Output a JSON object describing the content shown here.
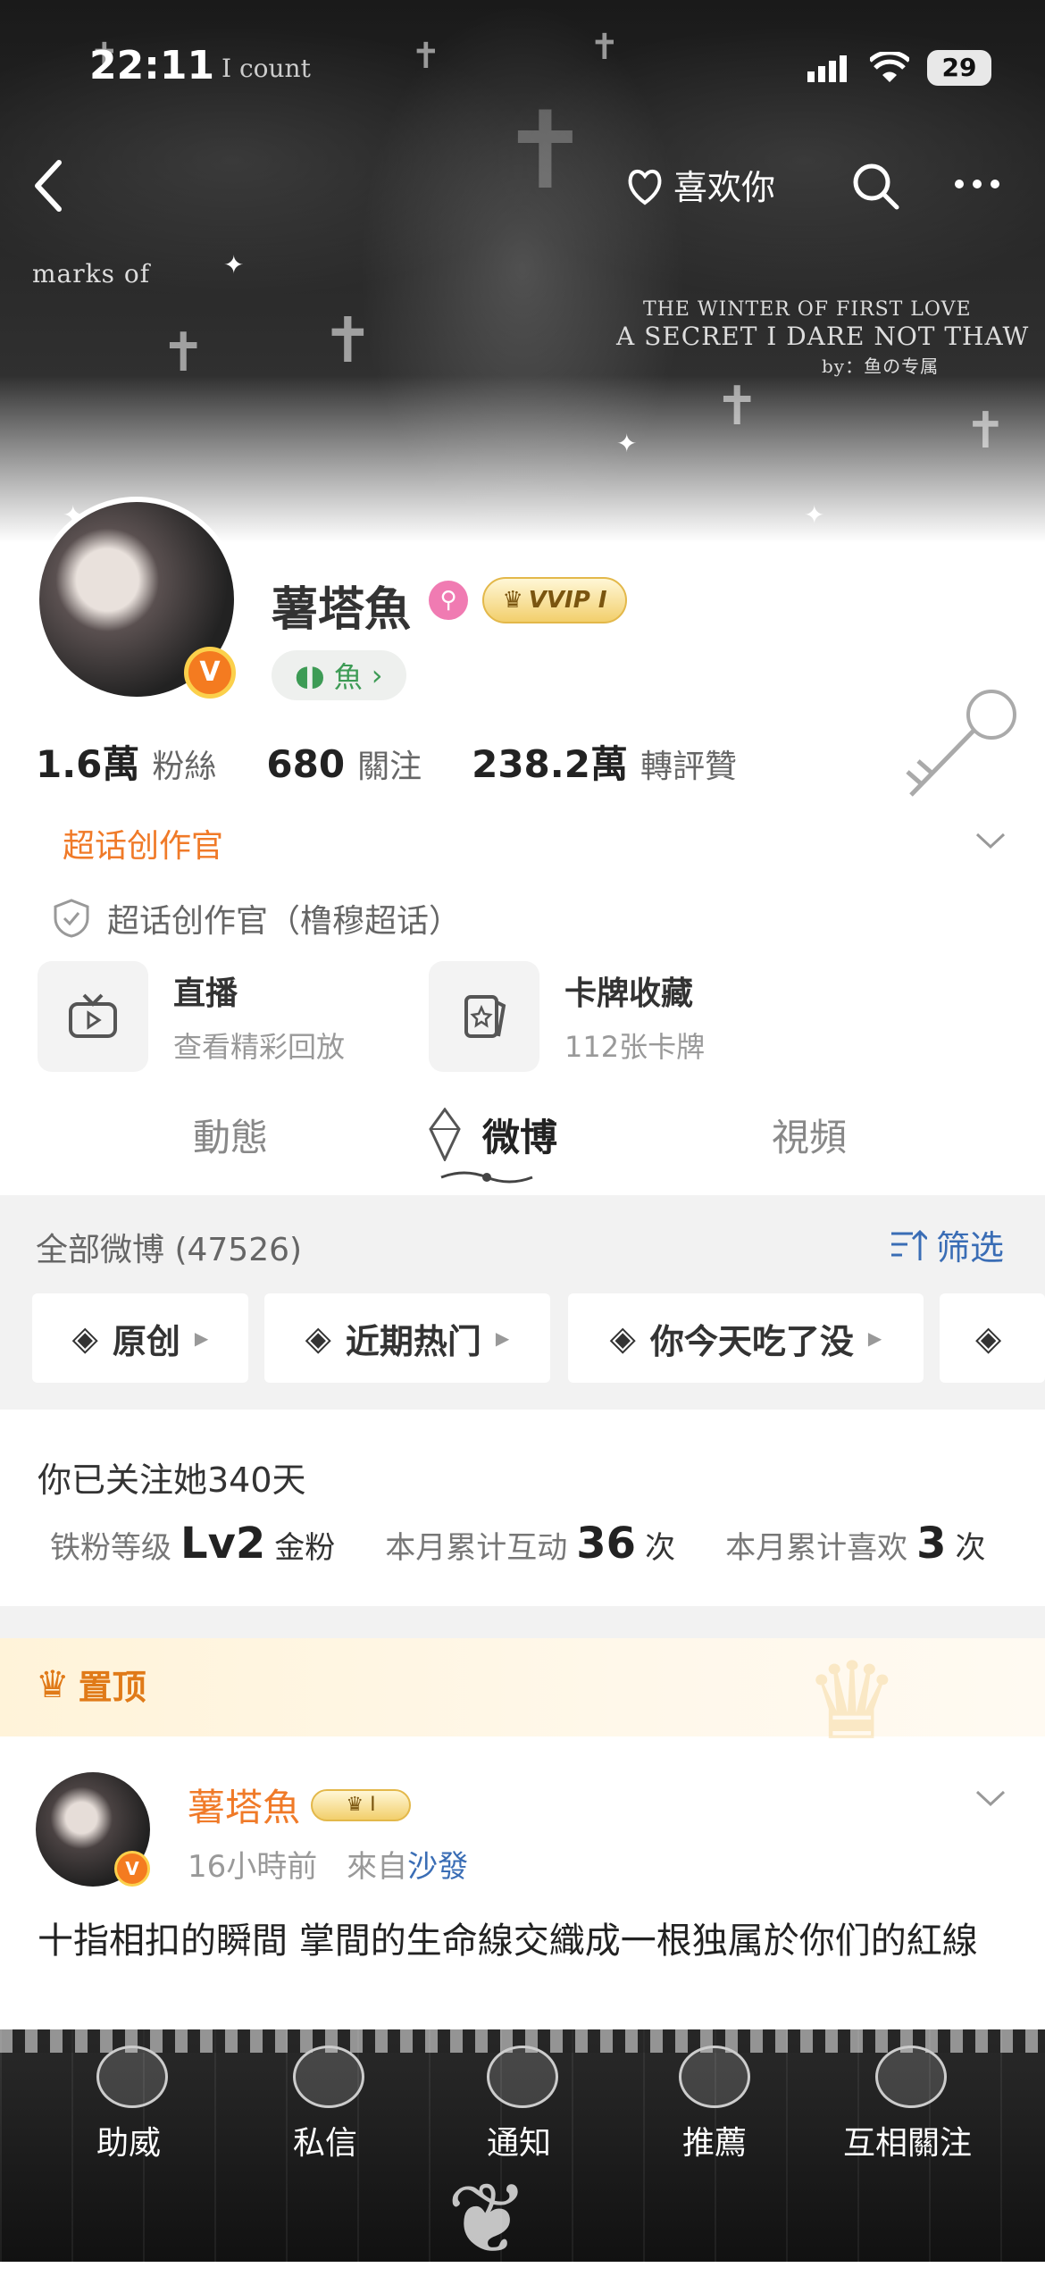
{
  "status_bar": {
    "time": "22:11",
    "subtitle": "I count",
    "battery": "29"
  },
  "banner": {
    "text_left": "marks of",
    "text_right_1": "THE WINTER OF FIRST LOVE",
    "text_right_2": "A SECRET I DARE NOT THAW",
    "text_right_3": "by：鱼の专属"
  },
  "nav": {
    "like_label": "喜欢你"
  },
  "profile": {
    "username": "薯塔魚",
    "vip_label": "VVIP I",
    "fish_tag": "魚",
    "stats": [
      {
        "num": "1.6萬",
        "label": "粉絲"
      },
      {
        "num": "680",
        "label": "關注"
      },
      {
        "num": "238.2萬",
        "label": "轉評贊"
      }
    ],
    "super_title": "超话创作官",
    "super_desc": "超话创作官（橹穆超话）",
    "cards": [
      {
        "title": "直播",
        "sub": "查看精彩回放"
      },
      {
        "title": "卡牌收藏",
        "sub": "112张卡牌"
      }
    ]
  },
  "tabs": [
    "動態",
    "微博",
    "視頻"
  ],
  "feed_header": {
    "all_label": "全部微博 (47526)",
    "filter_label": "筛选",
    "chips": [
      "原创",
      "近期热门",
      "你今天吃了没"
    ]
  },
  "fan_info": {
    "follow_days": "你已关注她340天",
    "level_label": "铁粉等级",
    "level_value": "Lv2",
    "level_suffix": "金粉",
    "interact_label": "本月累计互动",
    "interact_value": "36",
    "interact_unit": "次",
    "likes_label": "本月累计喜欢",
    "likes_value": "3",
    "likes_unit": "次"
  },
  "pinned": {
    "label": "置顶",
    "user": "薯塔魚",
    "time": "16小時前",
    "from_label": "來自",
    "source": "沙發",
    "body": "十指相扣的瞬間  掌間的生命線交織成一根独属於你们的紅線"
  },
  "bottom_nav": [
    "助威",
    "私信",
    "通知",
    "推薦",
    "互相關注"
  ]
}
